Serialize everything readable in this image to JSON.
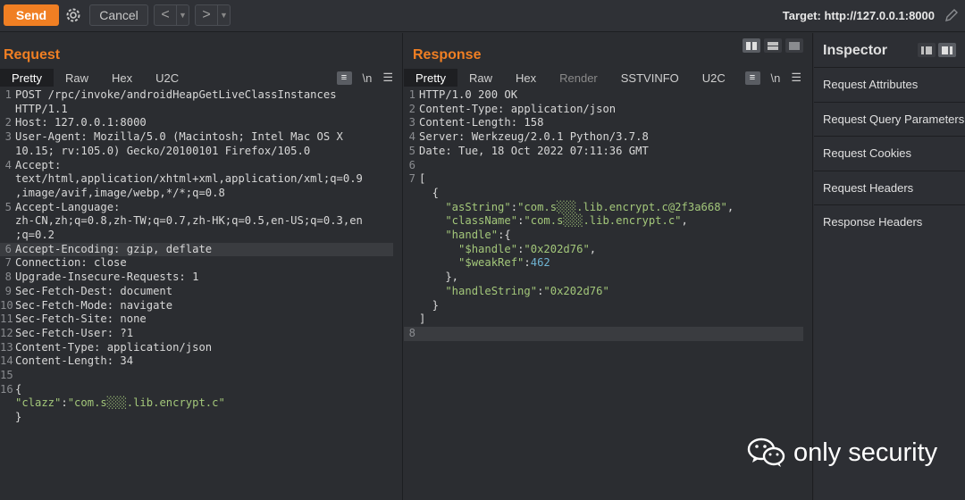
{
  "toolbar": {
    "send_label": "Send",
    "cancel_label": "Cancel",
    "back_arrow": "<",
    "forward_arrow": ">",
    "target_label": "Target: http://127.0.0.1:8000"
  },
  "request": {
    "title": "Request",
    "tabs": [
      "Pretty",
      "Raw",
      "Hex",
      "U2C"
    ],
    "newline_label": "\\n",
    "lines": [
      {
        "n": "1",
        "text": "POST /rpc/invoke/androidHeapGetLiveClassInstances"
      },
      {
        "n": "",
        "text": "HTTP/1.1"
      },
      {
        "n": "2",
        "text": "Host: 127.0.0.1:8000"
      },
      {
        "n": "3",
        "text": "User-Agent: Mozilla/5.0 (Macintosh; Intel Mac OS X"
      },
      {
        "n": "",
        "text": "10.15; rv:105.0) Gecko/20100101 Firefox/105.0"
      },
      {
        "n": "4",
        "text": "Accept:"
      },
      {
        "n": "",
        "text": "text/html,application/xhtml+xml,application/xml;q=0.9"
      },
      {
        "n": "",
        "text": ",image/avif,image/webp,*/*;q=0.8"
      },
      {
        "n": "5",
        "text": "Accept-Language:"
      },
      {
        "n": "",
        "text": "zh-CN,zh;q=0.8,zh-TW;q=0.7,zh-HK;q=0.5,en-US;q=0.3,en"
      },
      {
        "n": "",
        "text": ";q=0.2"
      },
      {
        "n": "6",
        "text": "Accept-Encoding: gzip, deflate"
      },
      {
        "n": "7",
        "text": "Connection: close"
      },
      {
        "n": "8",
        "text": "Upgrade-Insecure-Requests: 1"
      },
      {
        "n": "9",
        "text": "Sec-Fetch-Dest: document"
      },
      {
        "n": "10",
        "text": "Sec-Fetch-Mode: navigate"
      },
      {
        "n": "11",
        "text": "Sec-Fetch-Site: none"
      },
      {
        "n": "12",
        "text": "Sec-Fetch-User: ?1"
      },
      {
        "n": "13",
        "text": "Content-Type: application/json"
      },
      {
        "n": "14",
        "text": "Content-Length: 34"
      },
      {
        "n": "15",
        "text": ""
      },
      {
        "n": "16",
        "text": "{"
      },
      {
        "n": "",
        "key": "\"clazz\"",
        "sep": ":",
        "str": "\"com.s░░░.lib.encrypt.c\""
      },
      {
        "n": "",
        "text": "}"
      }
    ]
  },
  "response": {
    "title": "Response",
    "tabs": [
      "Pretty",
      "Raw",
      "Hex",
      "Render",
      "SSTVINFO",
      "U2C"
    ],
    "newline_label": "\\n",
    "lines": [
      {
        "n": "1",
        "text": "HTTP/1.0 200 OK"
      },
      {
        "n": "2",
        "text": "Content-Type: application/json"
      },
      {
        "n": "3",
        "text": "Content-Length: 158"
      },
      {
        "n": "4",
        "text": "Server: Werkzeug/2.0.1 Python/3.7.8"
      },
      {
        "n": "5",
        "text": "Date: Tue, 18 Oct 2022 07:11:36 GMT"
      },
      {
        "n": "6",
        "text": ""
      },
      {
        "n": "7",
        "text": "["
      },
      {
        "n": "",
        "text": "  {"
      },
      {
        "n": "",
        "key": "    \"asString\"",
        "sep": ":",
        "str": "\"com.s░░░.lib.encrypt.c@2f3a668\"",
        "tail": ","
      },
      {
        "n": "",
        "key": "    \"className\"",
        "sep": ":",
        "str": "\"com.s░░░.lib.encrypt.c\"",
        "tail": ","
      },
      {
        "n": "",
        "key": "    \"handle\"",
        "sep": ":{",
        "str": "",
        "tail": ""
      },
      {
        "n": "",
        "key": "      \"$handle\"",
        "sep": ":",
        "str": "\"0x202d76\"",
        "tail": ","
      },
      {
        "n": "",
        "key": "      \"$weakRef\"",
        "sep": ":",
        "num": "462",
        "tail": ""
      },
      {
        "n": "",
        "text": "    },"
      },
      {
        "n": "",
        "key": "    \"handleString\"",
        "sep": ":",
        "str": "\"0x202d76\"",
        "tail": ""
      },
      {
        "n": "",
        "text": "  }"
      },
      {
        "n": "",
        "text": "]"
      },
      {
        "n": "8",
        "text": ""
      }
    ]
  },
  "inspector": {
    "title": "Inspector",
    "items": [
      "Request Attributes",
      "Request Query Parameters",
      "Request Cookies",
      "Request Headers",
      "Response Headers"
    ]
  },
  "watermark": {
    "text": "only security"
  }
}
